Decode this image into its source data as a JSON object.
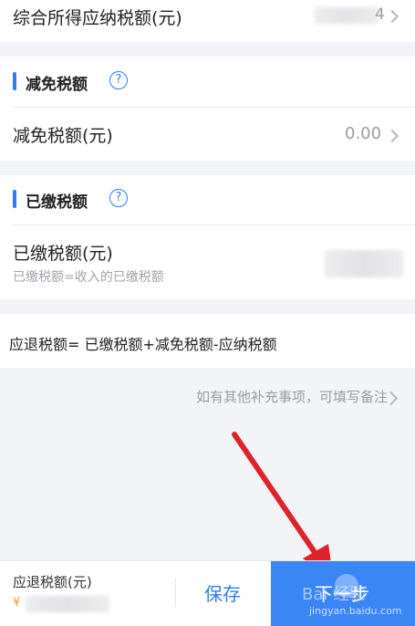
{
  "top_row": {
    "label": "综合所得应纳税额(元)",
    "value_suffix": "4"
  },
  "reduction": {
    "section_title": "减免税额",
    "help_glyph": "?",
    "row_label": "减免税额(元)",
    "row_value": "0.00"
  },
  "paid": {
    "section_title": "已缴税额",
    "help_glyph": "?",
    "row_label": "已缴税额(元)",
    "row_hint": "已缴税额=收入的已缴税额"
  },
  "formula": "应退税额= 已缴税额+减免税额-应纳税额",
  "note_link": "如有其他补充事项，可填写备注",
  "footer": {
    "refund_label": "应退税额(元)",
    "currency_symbol": "¥",
    "save_label": "保存",
    "next_label": "下一步"
  },
  "watermark": {
    "text_top": "Bai  经验",
    "text_bottom": "jingyan.baidu.com"
  },
  "colors": {
    "accent": "#2f7bf2",
    "arrow": "#e0232b",
    "bg": "#f3f4f8"
  }
}
